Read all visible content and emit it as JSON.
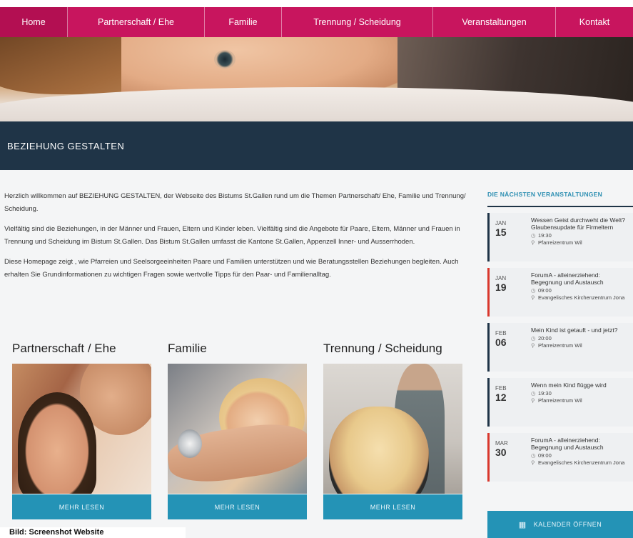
{
  "nav": {
    "items": [
      {
        "label": "Home",
        "active": true
      },
      {
        "label": "Partnerschaft / Ehe"
      },
      {
        "label": "Familie"
      },
      {
        "label": "Trennung / Scheidung"
      },
      {
        "label": "Veranstaltungen"
      },
      {
        "label": "Kontakt"
      }
    ]
  },
  "colors": {
    "nav": "#c8155e",
    "titlebar": "#1f3447",
    "button": "#2493b6",
    "accent_red": "#d9372c"
  },
  "header": {
    "title": "BEZIEHUNG GESTALTEN"
  },
  "intro": {
    "p1": "Herzlich willkommen auf BEZIEHUNG GESTALTEN, der Webseite des Bistums St.Gallen rund um die Themen Partnerschaft/ Ehe, Familie und Trennung/ Scheidung.",
    "p2": "Vielfältig sind die Beziehungen, in der Männer und Frauen, Eltern und Kinder leben. Vielfältig sind die Angebote für Paare, Eltern, Männer und Frauen in Trennung und Scheidung im Bistum St.Gallen. Das Bistum St.Gallen umfasst die Kantone St.Gallen, Appenzell Inner- und Ausserrhoden.",
    "p3": "Diese Homepage zeigt , wie Pfarreien und Seelsorgeeinheiten Paare und Familien unterstützen und wie Beratungsstellen Beziehungen begleiten. Auch erhalten Sie Grundinformationen zu wichtigen Fragen sowie wertvolle Tipps für den Paar- und Familienalltag."
  },
  "cards": [
    {
      "title": "Partnerschaft / Ehe",
      "button": "MEHR LESEN"
    },
    {
      "title": "Familie",
      "button": "MEHR LESEN"
    },
    {
      "title": "Trennung / Scheidung",
      "button": "MEHR LESEN"
    }
  ],
  "sidebar": {
    "title": "DIE NÄCHSTEN VERANSTALTUNGEN",
    "events": [
      {
        "month": "JAN",
        "day": "15",
        "title": "Wessen Geist durchweht die Welt? Glaubensupdate für Firmeltern",
        "time": "19:30",
        "place": "Pfarreizentrum Wil",
        "style": "dark"
      },
      {
        "month": "JAN",
        "day": "19",
        "title": "ForumA - alleinerziehend: Begegnung und Austausch",
        "time": "09:00",
        "place": "Evangelisches Kirchenzentrum Jona",
        "style": "red"
      },
      {
        "month": "FEB",
        "day": "06",
        "title": "Mein Kind ist getauft - und jetzt?",
        "time": "20:00",
        "place": "Pfarreizentrum Wil",
        "style": "dark"
      },
      {
        "month": "FEB",
        "day": "12",
        "title": "Wenn mein Kind flügge wird",
        "time": "19:30",
        "place": "Pfarreizentrum Wil",
        "style": "dark"
      },
      {
        "month": "MAR",
        "day": "30",
        "title": "ForumA - alleinerziehend: Begegnung und Austausch",
        "time": "09:00",
        "place": "Evangelisches Kirchenzentrum Jona",
        "style": "red"
      }
    ],
    "calendar_button": "KALENDER ÖFFNEN"
  },
  "caption": "Bild: Screenshot Website"
}
